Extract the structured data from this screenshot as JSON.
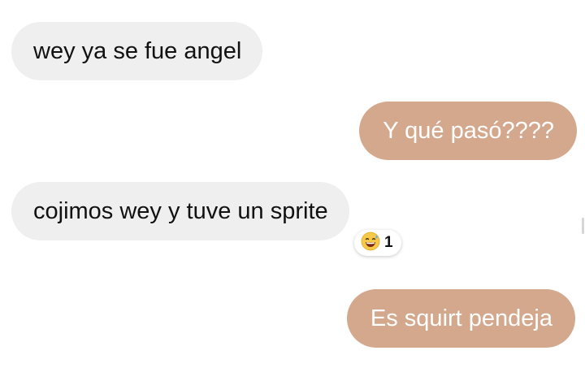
{
  "messages": [
    {
      "id": "msg1",
      "direction": "incoming",
      "text": "wey ya se fue angel"
    },
    {
      "id": "msg2",
      "direction": "outgoing",
      "text": "Y qué pasó????"
    },
    {
      "id": "msg3",
      "direction": "incoming",
      "text": "cojimos wey y tuve un sprite"
    },
    {
      "id": "msg4",
      "direction": "outgoing",
      "text": "Es squirt pendeja"
    }
  ],
  "reaction": {
    "emoji_icon": "grinning-sweat-face-icon",
    "count": "1"
  },
  "colors": {
    "incoming_bubble": "#efefef",
    "outgoing_bubble": "#d3a88c",
    "outgoing_text": "#ffffff",
    "incoming_text": "#111111"
  }
}
